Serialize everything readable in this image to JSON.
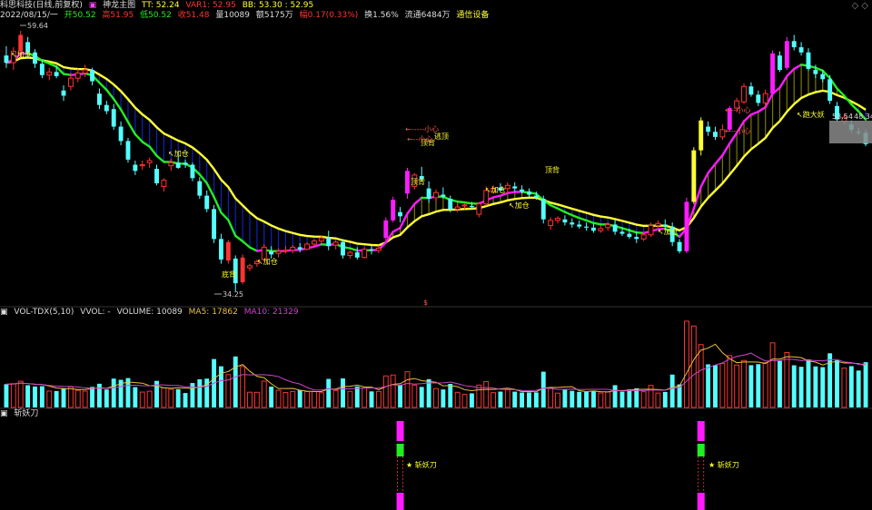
{
  "header": {
    "stock_name": "科思科技(日线,前复权)",
    "indicator_name": "神龙主图",
    "tt_label": "TT: 52.24",
    "var1_label": "VAR1: 52.95",
    "bb_label": "BB: 53.30 : 52.95",
    "date": "2022/08/15/一",
    "open": "开50.52",
    "high": "高51.95",
    "low": "低50.52",
    "close": "收51.48",
    "volume": "量10089",
    "amount": "额5175万",
    "change": "幅0.17(0.33%)",
    "turnover": "换1.56%",
    "float": "流通6484万",
    "sector": "通信设备",
    "window_icons": "◇  ◇"
  },
  "annotations": {
    "high_price": "59.64",
    "low_price": "34.25",
    "price_tag": "48.34",
    "price_tag2": "53.54",
    "jiacang": "加仓",
    "xiaoxin": "小心",
    "taoding": "逃顶",
    "dingbei": "顶背",
    "paodayao": "跑大妖",
    "dibei": "底背",
    "dollar": "$"
  },
  "vol_panel": {
    "title": "VOL-TDX(5,10)",
    "vvol": "VVOL: -",
    "volume": "VOLUME: 10089",
    "ma5": "MA5: 17862",
    "ma10": "MA10: 21329"
  },
  "blade_panel": {
    "title": "斩妖刀",
    "signal_label": "斩妖刀"
  },
  "colors": {
    "up": "#ff3333",
    "down": "#54ffff",
    "magenta": "#ff1cff",
    "green": "#22ee22",
    "yellow": "#ffff33",
    "ma5": "#e8c23c",
    "ma10": "#cc44cc"
  },
  "chart_data": {
    "type": "candlestick",
    "candles": [
      [
        57.2,
        58.1,
        56.0,
        56.5
      ],
      [
        56.5,
        58.0,
        55.8,
        57.6
      ],
      [
        57.6,
        59.6,
        57.0,
        59.2
      ],
      [
        58.5,
        59.0,
        57.0,
        57.5
      ],
      [
        57.5,
        57.8,
        56.0,
        56.4
      ],
      [
        56.4,
        56.8,
        55.0,
        55.3
      ],
      [
        55.3,
        56.0,
        54.8,
        55.6
      ],
      [
        55.6,
        56.2,
        55.0,
        55.2
      ],
      [
        53.8,
        54.3,
        52.8,
        53.3
      ],
      [
        54.2,
        55.5,
        53.8,
        55.0
      ],
      [
        55.0,
        55.9,
        54.6,
        55.5
      ],
      [
        55.5,
        56.3,
        55.1,
        55.8
      ],
      [
        55.8,
        56.0,
        54.3,
        54.7
      ],
      [
        53.5,
        54.0,
        52.0,
        52.4
      ],
      [
        52.4,
        52.8,
        51.5,
        51.8
      ],
      [
        52.0,
        52.5,
        50.0,
        50.3
      ],
      [
        50.3,
        50.8,
        48.5,
        48.9
      ],
      [
        48.9,
        49.2,
        46.8,
        47.1
      ],
      [
        46.6,
        47.0,
        45.6,
        46.0
      ],
      [
        46.5,
        47.0,
        46.1,
        46.6
      ],
      [
        46.8,
        47.3,
        46.3,
        47.0
      ],
      [
        46.2,
        46.6,
        44.6,
        44.8
      ],
      [
        44.5,
        45.3,
        44.0,
        45.1
      ],
      [
        46.5,
        47.2,
        46.0,
        46.8
      ],
      [
        46.8,
        47.4,
        46.2,
        46.3
      ],
      [
        46.8,
        47.1,
        46.3,
        46.6
      ],
      [
        46.6,
        46.8,
        45.0,
        45.3
      ],
      [
        45.0,
        45.4,
        43.3,
        43.6
      ],
      [
        43.6,
        44.1,
        42.0,
        42.3
      ],
      [
        42.3,
        42.7,
        39.0,
        39.4
      ],
      [
        39.4,
        39.9,
        37.0,
        37.4
      ],
      [
        37.3,
        39.3,
        37.0,
        39.1
      ],
      [
        37.5,
        37.8,
        34.3,
        35.1
      ],
      [
        35.2,
        37.9,
        35.0,
        37.6
      ],
      [
        36.6,
        37.0,
        36.3,
        36.8
      ],
      [
        37.0,
        37.4,
        36.7,
        37.2
      ],
      [
        37.4,
        38.9,
        37.2,
        38.6
      ],
      [
        38.2,
        38.7,
        37.5,
        37.9
      ],
      [
        38.0,
        38.5,
        37.6,
        38.2
      ],
      [
        38.2,
        38.7,
        38.0,
        38.3
      ],
      [
        38.3,
        38.8,
        38.0,
        38.6
      ],
      [
        38.6,
        39.0,
        38.1,
        38.4
      ],
      [
        38.4,
        39.1,
        38.3,
        38.9
      ],
      [
        38.9,
        39.4,
        38.6,
        39.2
      ],
      [
        39.2,
        39.7,
        39.0,
        39.5
      ],
      [
        39.5,
        40.2,
        38.3,
        38.7
      ],
      [
        38.8,
        39.3,
        38.4,
        39.1
      ],
      [
        39.1,
        39.4,
        37.5,
        37.8
      ],
      [
        37.8,
        38.3,
        37.5,
        38.1
      ],
      [
        38.1,
        38.6,
        37.4,
        37.6
      ],
      [
        37.6,
        38.6,
        37.5,
        38.4
      ],
      [
        38.4,
        38.7,
        37.9,
        38.3
      ],
      [
        38.3,
        38.8,
        38.0,
        38.5
      ],
      [
        39.5,
        41.5,
        39.2,
        41.2
      ],
      [
        41.2,
        43.5,
        41.0,
        43.2
      ],
      [
        42.0,
        42.5,
        41.0,
        41.6
      ],
      [
        43.8,
        46.3,
        43.3,
        46.0
      ],
      [
        44.5,
        45.8,
        44.2,
        45.6
      ],
      [
        45.5,
        46.4,
        45.0,
        45.2
      ],
      [
        44.3,
        45.0,
        42.9,
        43.3
      ],
      [
        43.4,
        44.2,
        43.0,
        43.9
      ],
      [
        43.7,
        44.4,
        43.3,
        43.5
      ],
      [
        43.3,
        43.6,
        42.0,
        42.3
      ],
      [
        42.3,
        42.8,
        42.0,
        42.5
      ],
      [
        42.6,
        42.9,
        42.3,
        42.7
      ],
      [
        42.6,
        43.0,
        42.3,
        42.5
      ],
      [
        41.8,
        43.0,
        41.5,
        42.8
      ],
      [
        42.8,
        44.5,
        42.6,
        44.1
      ],
      [
        44.0,
        44.6,
        43.8,
        44.3
      ],
      [
        44.4,
        44.8,
        43.9,
        44.1
      ],
      [
        44.3,
        44.9,
        43.8,
        44.6
      ],
      [
        44.5,
        44.9,
        44.0,
        44.3
      ],
      [
        44.2,
        44.6,
        43.8,
        44.0
      ],
      [
        44.0,
        44.3,
        43.5,
        43.7
      ],
      [
        43.6,
        44.0,
        43.2,
        43.4
      ],
      [
        43.3,
        43.6,
        40.9,
        41.3
      ],
      [
        40.7,
        41.5,
        40.3,
        41.2
      ],
      [
        41.2,
        41.6,
        40.9,
        41.4
      ],
      [
        41.3,
        41.7,
        40.7,
        41.0
      ],
      [
        41.0,
        41.4,
        40.5,
        40.8
      ],
      [
        40.8,
        41.2,
        40.4,
        40.6
      ],
      [
        40.6,
        41.0,
        40.2,
        40.5
      ],
      [
        40.5,
        40.9,
        40.0,
        40.2
      ],
      [
        40.2,
        40.7,
        40.0,
        40.4
      ],
      [
        40.5,
        41.0,
        40.2,
        40.8
      ],
      [
        40.8,
        41.2,
        39.8,
        40.1
      ],
      [
        40.1,
        40.5,
        39.7,
        39.9
      ],
      [
        39.9,
        40.4,
        39.4,
        39.6
      ],
      [
        39.6,
        40.1,
        39.0,
        39.4
      ],
      [
        39.4,
        40.0,
        39.2,
        39.8
      ],
      [
        39.8,
        41.0,
        39.6,
        40.7
      ],
      [
        40.7,
        41.2,
        40.5,
        40.9
      ],
      [
        40.8,
        41.3,
        40.5,
        40.6
      ],
      [
        40.6,
        41.0,
        38.7,
        39.1
      ],
      [
        39.1,
        39.4,
        38.0,
        38.2
      ],
      [
        38.2,
        43.4,
        38.0,
        43.0
      ],
      [
        43.0,
        48.3,
        42.8,
        48.0
      ],
      [
        48.0,
        51.2,
        47.5,
        50.9
      ],
      [
        50.3,
        50.8,
        49.4,
        49.8
      ],
      [
        49.8,
        50.3,
        49.0,
        49.3
      ],
      [
        49.3,
        50.5,
        49.0,
        50.0
      ],
      [
        50.0,
        52.3,
        49.8,
        52.1
      ],
      [
        52.1,
        53.1,
        51.7,
        52.8
      ],
      [
        52.7,
        54.5,
        52.5,
        54.2
      ],
      [
        54.2,
        54.6,
        53.2,
        53.4
      ],
      [
        53.4,
        53.8,
        52.3,
        52.6
      ],
      [
        52.6,
        53.9,
        52.2,
        53.5
      ],
      [
        53.5,
        57.7,
        53.3,
        57.4
      ],
      [
        57.2,
        57.6,
        55.6,
        55.8
      ],
      [
        56.0,
        59.0,
        55.8,
        58.6
      ],
      [
        58.6,
        59.2,
        57.7,
        58.0
      ],
      [
        58.0,
        58.5,
        57.2,
        57.5
      ],
      [
        57.5,
        57.9,
        55.7,
        55.9
      ],
      [
        55.8,
        56.3,
        55.0,
        55.4
      ],
      [
        55.4,
        55.8,
        54.6,
        54.9
      ],
      [
        54.9,
        55.3,
        52.5,
        52.8
      ],
      [
        52.3,
        52.7,
        50.8,
        51.0
      ],
      [
        50.8,
        51.5,
        50.5,
        51.2
      ],
      [
        50.5,
        50.9,
        49.7,
        50.0
      ],
      [
        49.8,
        50.2,
        49.5,
        49.7
      ],
      [
        49.7,
        50.0,
        48.4,
        48.6
      ]
    ],
    "xlim": [
      0,
      120
    ],
    "ylim": [
      33.0,
      61.0
    ]
  }
}
